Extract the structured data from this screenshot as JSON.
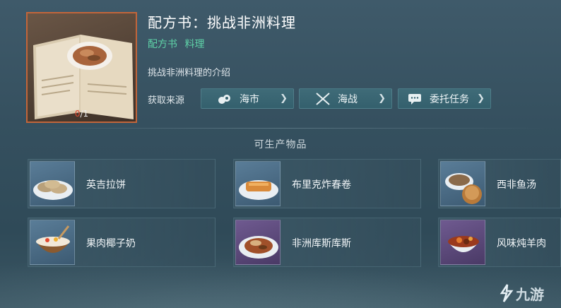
{
  "recipe": {
    "title": "配方书：挑战非洲料理",
    "tags": [
      "配方书",
      "料理"
    ],
    "description": "挑战非洲料理的介绍",
    "count_owned": "0",
    "count_total": "/1"
  },
  "source": {
    "label": "获取来源",
    "buttons": [
      {
        "label": "海市",
        "icon": "market-icon"
      },
      {
        "label": "海战",
        "icon": "crossed-swords-icon"
      },
      {
        "label": "委托任务",
        "icon": "chat-bubble-icon"
      }
    ]
  },
  "products": {
    "section_title": "可生产物品",
    "items": [
      {
        "name": "英吉拉饼",
        "rarity": "blue"
      },
      {
        "name": "布里克炸春卷",
        "rarity": "blue"
      },
      {
        "name": "西非鱼汤",
        "rarity": "blue"
      },
      {
        "name": "果肉椰子奶",
        "rarity": "blue"
      },
      {
        "name": "非洲库斯库斯",
        "rarity": "purple"
      },
      {
        "name": "风味炖羊肉",
        "rarity": "purple"
      }
    ]
  },
  "watermark": "九游",
  "colors": {
    "accent_green": "#5fd3a8",
    "frame_orange": "#c2653a",
    "count_red": "#e2482f"
  }
}
